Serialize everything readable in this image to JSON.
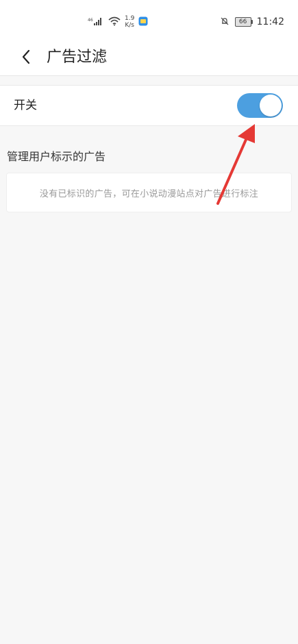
{
  "status_bar": {
    "signal_tag": "46",
    "net_speed_value": "1.9",
    "net_speed_unit": "K/s",
    "battery_level": "66",
    "time": "11:42",
    "icons": [
      "signal-icon",
      "wifi-icon",
      "message-app-icon",
      "mute-bell-icon",
      "battery-icon"
    ]
  },
  "header": {
    "title": "广告过滤",
    "back_icon": "chevron-left-icon"
  },
  "switch_row": {
    "label": "开关",
    "enabled": true,
    "accent_color": "#4c9fe0"
  },
  "section": {
    "title": "管理用户标示的广告",
    "empty_message": "没有已标识的广告，可在小说动漫站点对广告进行标注"
  },
  "annotation": {
    "icon": "red-arrow-icon",
    "color": "#e53935"
  }
}
